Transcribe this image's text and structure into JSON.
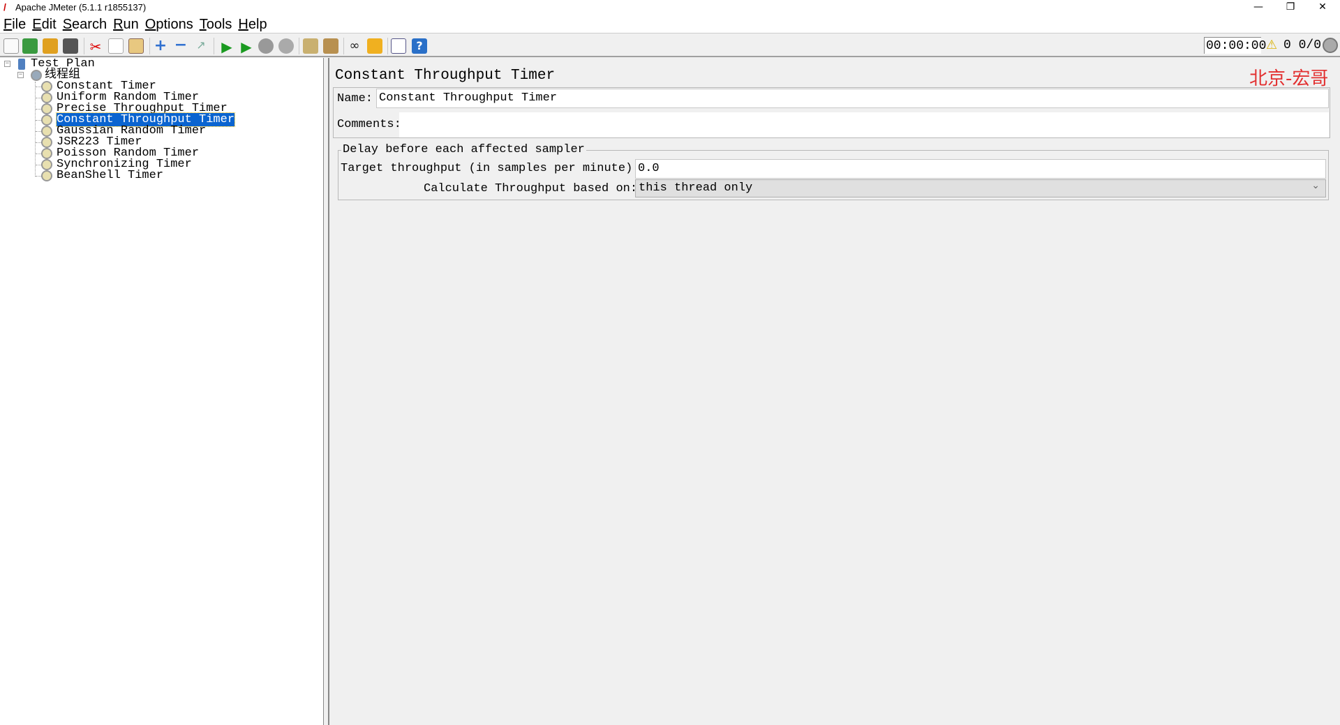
{
  "window": {
    "title": "Apache JMeter (5.1.1 r1855137)",
    "minimize": "—",
    "restore": "❐",
    "close": "✕"
  },
  "menu": [
    "File",
    "Edit",
    "Search",
    "Run",
    "Options",
    "Tools",
    "Help"
  ],
  "toolbar": {
    "icons": [
      "new-icon",
      "templates-icon",
      "open-icon",
      "save-icon",
      "cut-icon",
      "copy-icon",
      "paste-icon",
      "expand-icon",
      "collapse-icon",
      "toggle-icon",
      "start-icon",
      "start-no-pauses-icon",
      "stop-icon",
      "shutdown-icon",
      "clear-icon",
      "clear-all-icon",
      "search-icon",
      "reset-search-icon",
      "function-helper-icon",
      "help-icon"
    ],
    "timer": "00:00:00",
    "warning_count": "0",
    "threads": "0/0"
  },
  "tree": {
    "root": "Test Plan",
    "thread_group": "线程组",
    "items": [
      "Constant Timer",
      "Uniform Random Timer",
      "Precise Throughput Timer",
      "Constant Throughput Timer",
      "Gaussian Random Timer",
      "JSR223 Timer",
      "Poisson Random Timer",
      "Synchronizing Timer",
      "BeanShell Timer"
    ],
    "selected": "Constant Throughput Timer"
  },
  "panel": {
    "title": "Constant Throughput Timer",
    "watermark": "北京-宏哥",
    "name_label": "Name:",
    "name_value": "Constant Throughput Timer",
    "comments_label": "Comments:",
    "comments_value": "",
    "group_title": "Delay before each affected sampler",
    "target_label": "Target throughput (in samples per minute):",
    "target_value": "0.0",
    "calc_label": "Calculate Throughput based on:",
    "calc_value": "this thread only"
  }
}
